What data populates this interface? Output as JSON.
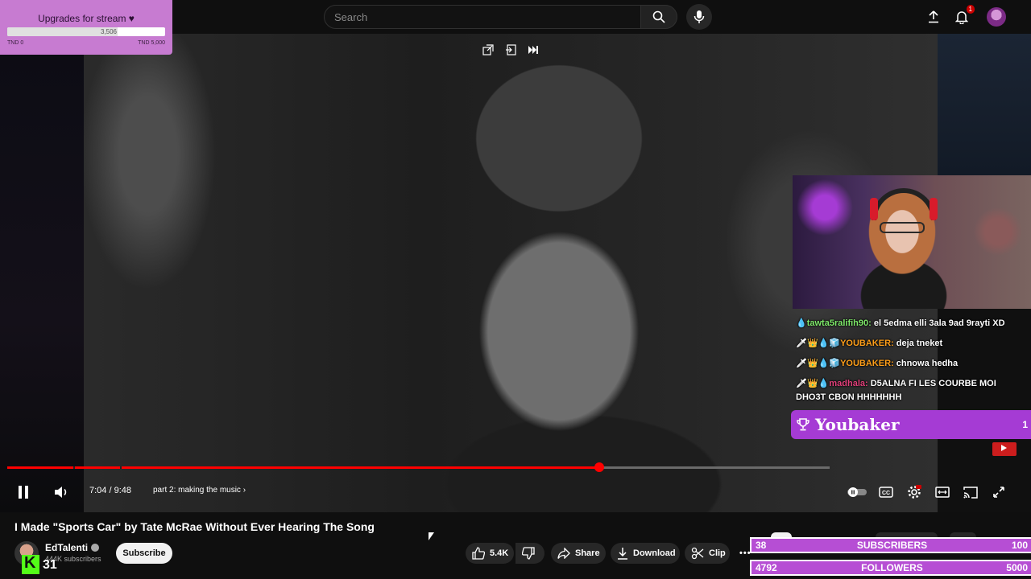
{
  "header": {
    "search_placeholder": "Search",
    "notification_count": "1"
  },
  "goal": {
    "title": "Upgrades for stream ♥",
    "current": "3,506",
    "min_label": "TND 0",
    "max_label": "TND 5,000",
    "progress_fraction": 0.7012
  },
  "player": {
    "current_time": "7:04",
    "duration": "9:48",
    "time_display": "7:04 / 9:48",
    "chapter": "part 2: making the music",
    "progress_fraction": 0.72,
    "buffered_fraction": 1.0
  },
  "chat": {
    "messages": [
      {
        "user": "tawta5ralifih90:",
        "text": "el 5edma elli 3ala 9ad 9rayti XD",
        "badges": "💧"
      },
      {
        "user": "YOUBAKER:",
        "text": "deja tneket",
        "badges": "🗡👑💧🧊"
      },
      {
        "user": "YOUBAKER:",
        "text": "chnowa hedha",
        "badges": "🗡👑💧🧊"
      },
      {
        "user": "madhala:",
        "text": "D5ALNA FI LES COURBE MOI DHO3T CBON HHHHHHH",
        "badges": "🗡👑💧"
      }
    ]
  },
  "leader": {
    "name": "Youbaker",
    "rank": "1"
  },
  "video": {
    "title": "I Made \"Sports Car\" by Tate McRae Without Ever Hearing The Song",
    "channel": "EdTalenti",
    "subscribers": "444K subscribers",
    "subscribe_label": "Subscribe",
    "likes": "5.4K",
    "share_label": "Share",
    "download_label": "Download",
    "clip_label": "Clip"
  },
  "kick": {
    "viewers": "31"
  },
  "chips": [
    "All",
    "From EdTalenti",
    "Tate"
  ],
  "stats": {
    "subscribers": {
      "current": "38",
      "label": "SUBSCRIBERS",
      "goal": "100"
    },
    "followers": {
      "current": "4792",
      "label": "FOLLOWERS",
      "goal": "5000"
    }
  },
  "colors": {
    "accent": "#ff0000",
    "overlay_purple": "#b64ed4",
    "goal_bg": "#c77bd1"
  }
}
